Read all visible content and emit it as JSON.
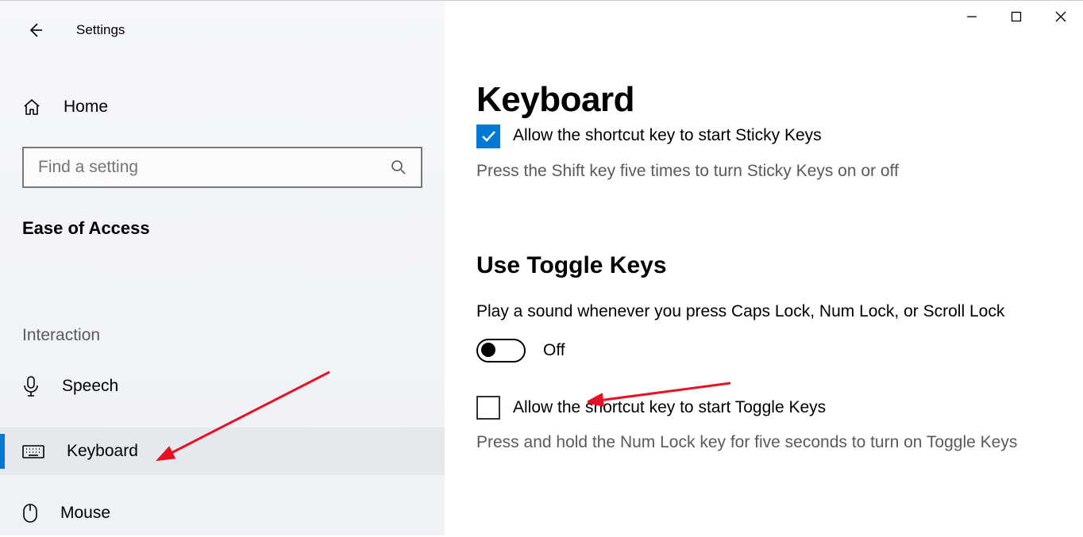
{
  "window": {
    "app_title": "Settings"
  },
  "sidebar": {
    "home_label": "Home",
    "search_placeholder": "Find a setting",
    "section_label": "Ease of Access",
    "group_label": "Interaction",
    "items": [
      {
        "label": "Speech",
        "selected": false
      },
      {
        "label": "Keyboard",
        "selected": true
      },
      {
        "label": "Mouse",
        "selected": false
      }
    ]
  },
  "main": {
    "page_title": "Keyboard",
    "sticky_keys": {
      "shortcut_checkbox_label": "Allow the shortcut key to start Sticky Keys",
      "shortcut_hint": "Press the Shift key five times to turn Sticky Keys on or off"
    },
    "toggle_keys": {
      "heading": "Use Toggle Keys",
      "description": "Play a sound whenever you press Caps Lock, Num Lock, or Scroll Lock",
      "toggle_state": "Off",
      "shortcut_checkbox_label": "Allow the shortcut key to start Toggle Keys",
      "shortcut_hint": "Press and hold the Num Lock key for five seconds to turn on Toggle Keys"
    }
  }
}
